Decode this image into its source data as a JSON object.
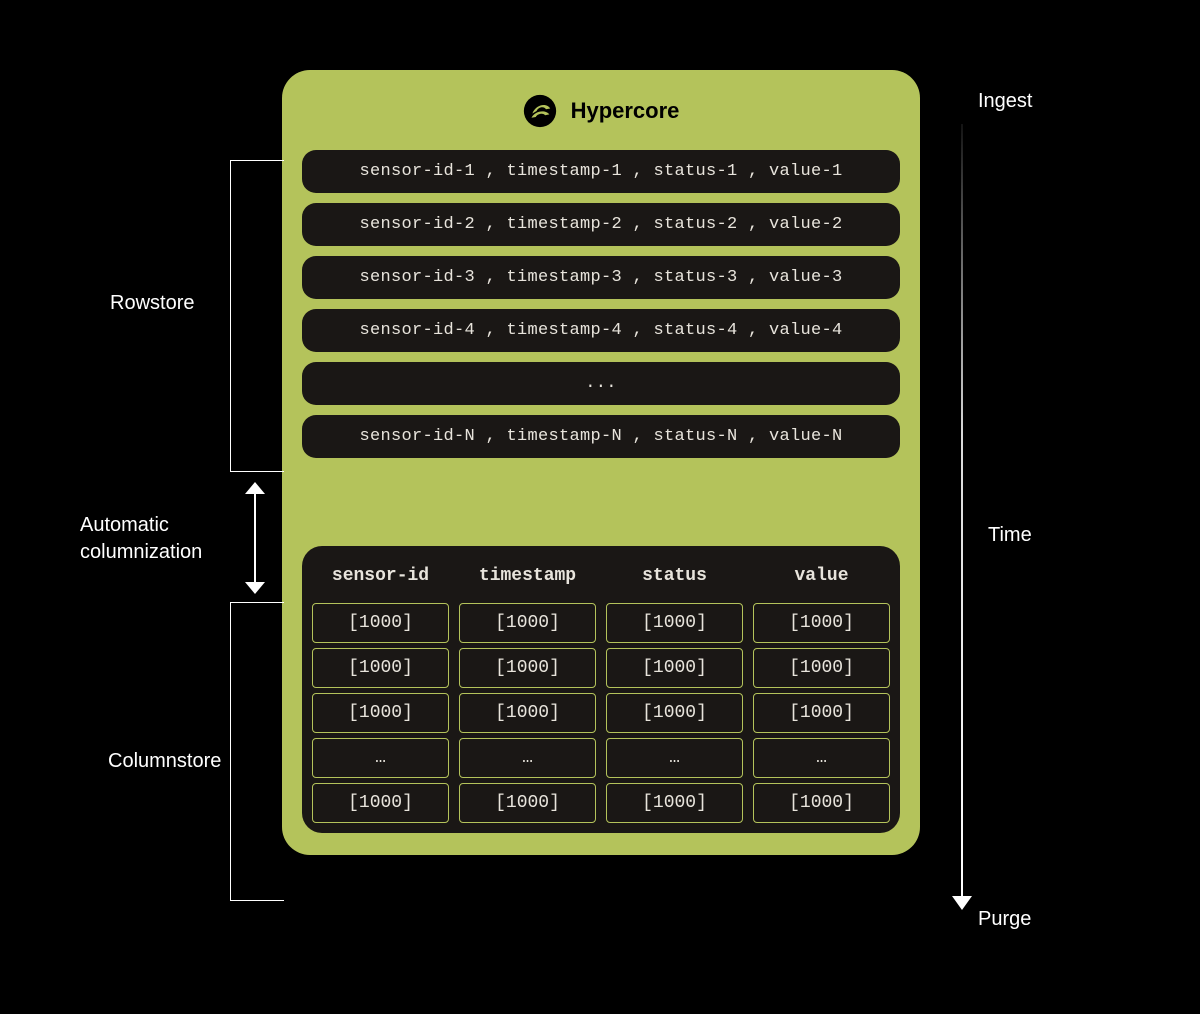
{
  "title": "Hypercore",
  "labels": {
    "rowstore": "Rowstore",
    "automatic": "Automatic\ncolumnization",
    "columnstore": "Columnstore",
    "ingest": "Ingest",
    "time": "Time",
    "purge": "Purge"
  },
  "rowstore": {
    "rows": [
      "sensor-id-1 , timestamp-1 , status-1 , value-1",
      "sensor-id-2 , timestamp-2 , status-2 , value-2",
      "sensor-id-3 , timestamp-3 , status-3 , value-3",
      "sensor-id-4 , timestamp-4 , status-4 , value-4",
      "...",
      "sensor-id-N , timestamp-N , status-N , value-N"
    ]
  },
  "columnstore": {
    "headers": [
      "sensor-id",
      "timestamp",
      "status",
      "value"
    ],
    "rows": [
      [
        "[1000]",
        "[1000]",
        "[1000]",
        "[1000]"
      ],
      [
        "[1000]",
        "[1000]",
        "[1000]",
        "[1000]"
      ],
      [
        "[1000]",
        "[1000]",
        "[1000]",
        "[1000]"
      ],
      [
        "…",
        "…",
        "…",
        "…"
      ],
      [
        "[1000]",
        "[1000]",
        "[1000]",
        "[1000]"
      ]
    ]
  },
  "colors": {
    "background": "#000000",
    "panel": "#b4c35b",
    "block": "#1a1715",
    "text_light": "#e8e4dc"
  }
}
